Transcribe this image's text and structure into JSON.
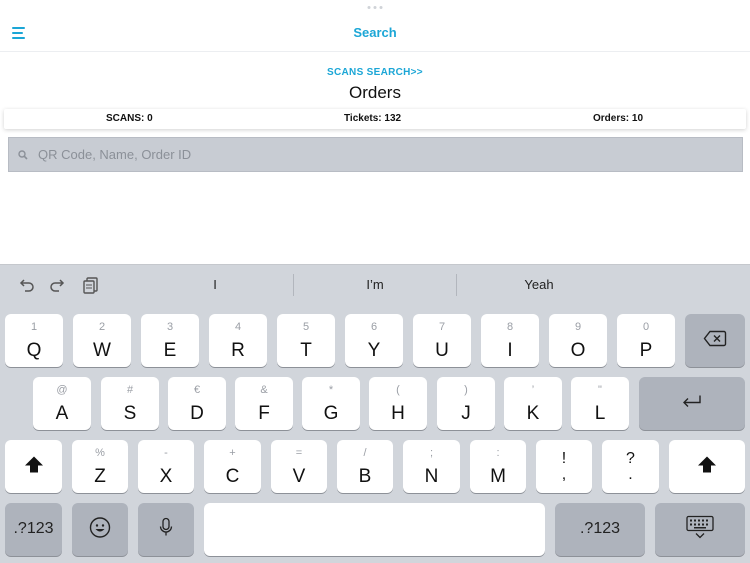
{
  "nav": {
    "title": "Search",
    "menu_icon": "hamburger-icon"
  },
  "header": {
    "scans_link": "SCANS SEARCH>>",
    "title": "Orders"
  },
  "stats": {
    "scans": "SCANS: 0",
    "tickets": "Tickets: 132",
    "orders": "Orders: 10"
  },
  "search": {
    "placeholder": "QR Code, Name, Order ID",
    "value": "",
    "icon": "search-icon"
  },
  "colors": {
    "accent": "#1ba6d6",
    "search_bg": "#c8ccd3",
    "keyboard_bg": "#d1d5db",
    "dark_key": "#aeb3bc"
  },
  "keyboard": {
    "toolbar": {
      "undo_icon": "undo-icon",
      "redo_icon": "redo-icon",
      "paste_icon": "paste-icon"
    },
    "predictions": [
      "I",
      "I’m",
      "Yeah"
    ],
    "row1": [
      {
        "hint": "1",
        "key": "Q"
      },
      {
        "hint": "2",
        "key": "W"
      },
      {
        "hint": "3",
        "key": "E"
      },
      {
        "hint": "4",
        "key": "R"
      },
      {
        "hint": "5",
        "key": "T"
      },
      {
        "hint": "6",
        "key": "Y"
      },
      {
        "hint": "7",
        "key": "U"
      },
      {
        "hint": "8",
        "key": "I"
      },
      {
        "hint": "9",
        "key": "O"
      },
      {
        "hint": "0",
        "key": "P"
      }
    ],
    "row2": [
      {
        "hint": "@",
        "key": "A"
      },
      {
        "hint": "#",
        "key": "S"
      },
      {
        "hint": "€",
        "key": "D"
      },
      {
        "hint": "&",
        "key": "F"
      },
      {
        "hint": "*",
        "key": "G"
      },
      {
        "hint": "(",
        "key": "H"
      },
      {
        "hint": ")",
        "key": "J"
      },
      {
        "hint": "’",
        "key": "K"
      },
      {
        "hint": "\"",
        "key": "L"
      }
    ],
    "row3": [
      {
        "hint": "%",
        "key": "Z"
      },
      {
        "hint": "-",
        "key": "X"
      },
      {
        "hint": "+",
        "key": "C"
      },
      {
        "hint": "=",
        "key": "V"
      },
      {
        "hint": "/",
        "key": "B"
      },
      {
        "hint": ";",
        "key": "N"
      },
      {
        "hint": ":",
        "key": "M"
      }
    ],
    "punct": [
      {
        "top": "!",
        "bottom": ","
      },
      {
        "top": "?",
        "bottom": "."
      }
    ],
    "numbers_key": ".?123",
    "emoji_icon": "emoji-icon",
    "mic_icon": "microphone-icon",
    "hide_icon": "keyboard-hide-icon",
    "delete_icon": "backspace-icon",
    "return_icon": "return-icon",
    "shift_icon": "shift-icon"
  }
}
